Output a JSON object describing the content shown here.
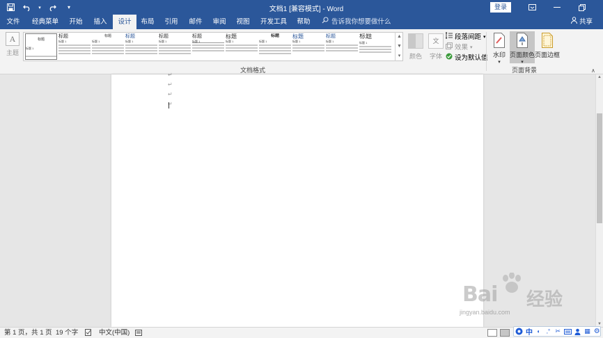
{
  "title_bar": {
    "doc_title": "文档1 [兼容模式] - Word",
    "login_label": "登录",
    "icons": [
      "save-icon",
      "undo-icon",
      "redo-icon",
      "customize-qat-icon"
    ]
  },
  "tabs": [
    {
      "label": "文件"
    },
    {
      "label": "经典菜单"
    },
    {
      "label": "开始"
    },
    {
      "label": "插入"
    },
    {
      "label": "设计",
      "active": true
    },
    {
      "label": "布局"
    },
    {
      "label": "引用"
    },
    {
      "label": "邮件"
    },
    {
      "label": "审阅"
    },
    {
      "label": "视图"
    },
    {
      "label": "开发工具"
    },
    {
      "label": "帮助"
    }
  ],
  "tell_me": "告诉我你想要做什么",
  "share_label": "共享",
  "ribbon": {
    "theme_label": "主题",
    "gallery": [
      {
        "title": "标题",
        "heading": "标题 1"
      },
      {
        "title": "标题",
        "heading": "标题 1"
      },
      {
        "title": "标题",
        "heading": "标题 1"
      },
      {
        "title": "标题",
        "heading": "标题 1"
      },
      {
        "title": "标题",
        "heading": "标题 1"
      },
      {
        "title": "标题",
        "heading": "标题 1"
      },
      {
        "title": "标题",
        "heading": "标题 1"
      },
      {
        "title": "标题",
        "heading": "标题 1"
      },
      {
        "title": "标题",
        "heading": "标题 1"
      },
      {
        "title": "标题",
        "heading": "标题 1"
      },
      {
        "title": "标题",
        "heading": "标题 1"
      }
    ],
    "colors_label": "颜色",
    "fonts_label": "字体",
    "paragraph_spacing_label": "段落间距",
    "effects_label": "效果",
    "set_default_label": "设为默认值",
    "group_doc_format": "文档格式",
    "watermark_label": "水印",
    "page_color_label": "页面颜色",
    "page_border_label": "页面边框",
    "group_page_background": "页面背景"
  },
  "document": {
    "paragraph_mark": "↵"
  },
  "status_bar": {
    "page_info": "第 1 页，共 1 页",
    "word_count": "19 个字",
    "language": "中文(中国)"
  },
  "watermark": {
    "brand": "Bai",
    "brand_cn": "经验",
    "url": "jingyan.baidu.com"
  },
  "ime": {
    "mode": "中"
  },
  "colors": {
    "accent": "#2b579a",
    "ribbon_bg": "#f3f3f3",
    "canvas_bg": "#e6e6e6"
  }
}
